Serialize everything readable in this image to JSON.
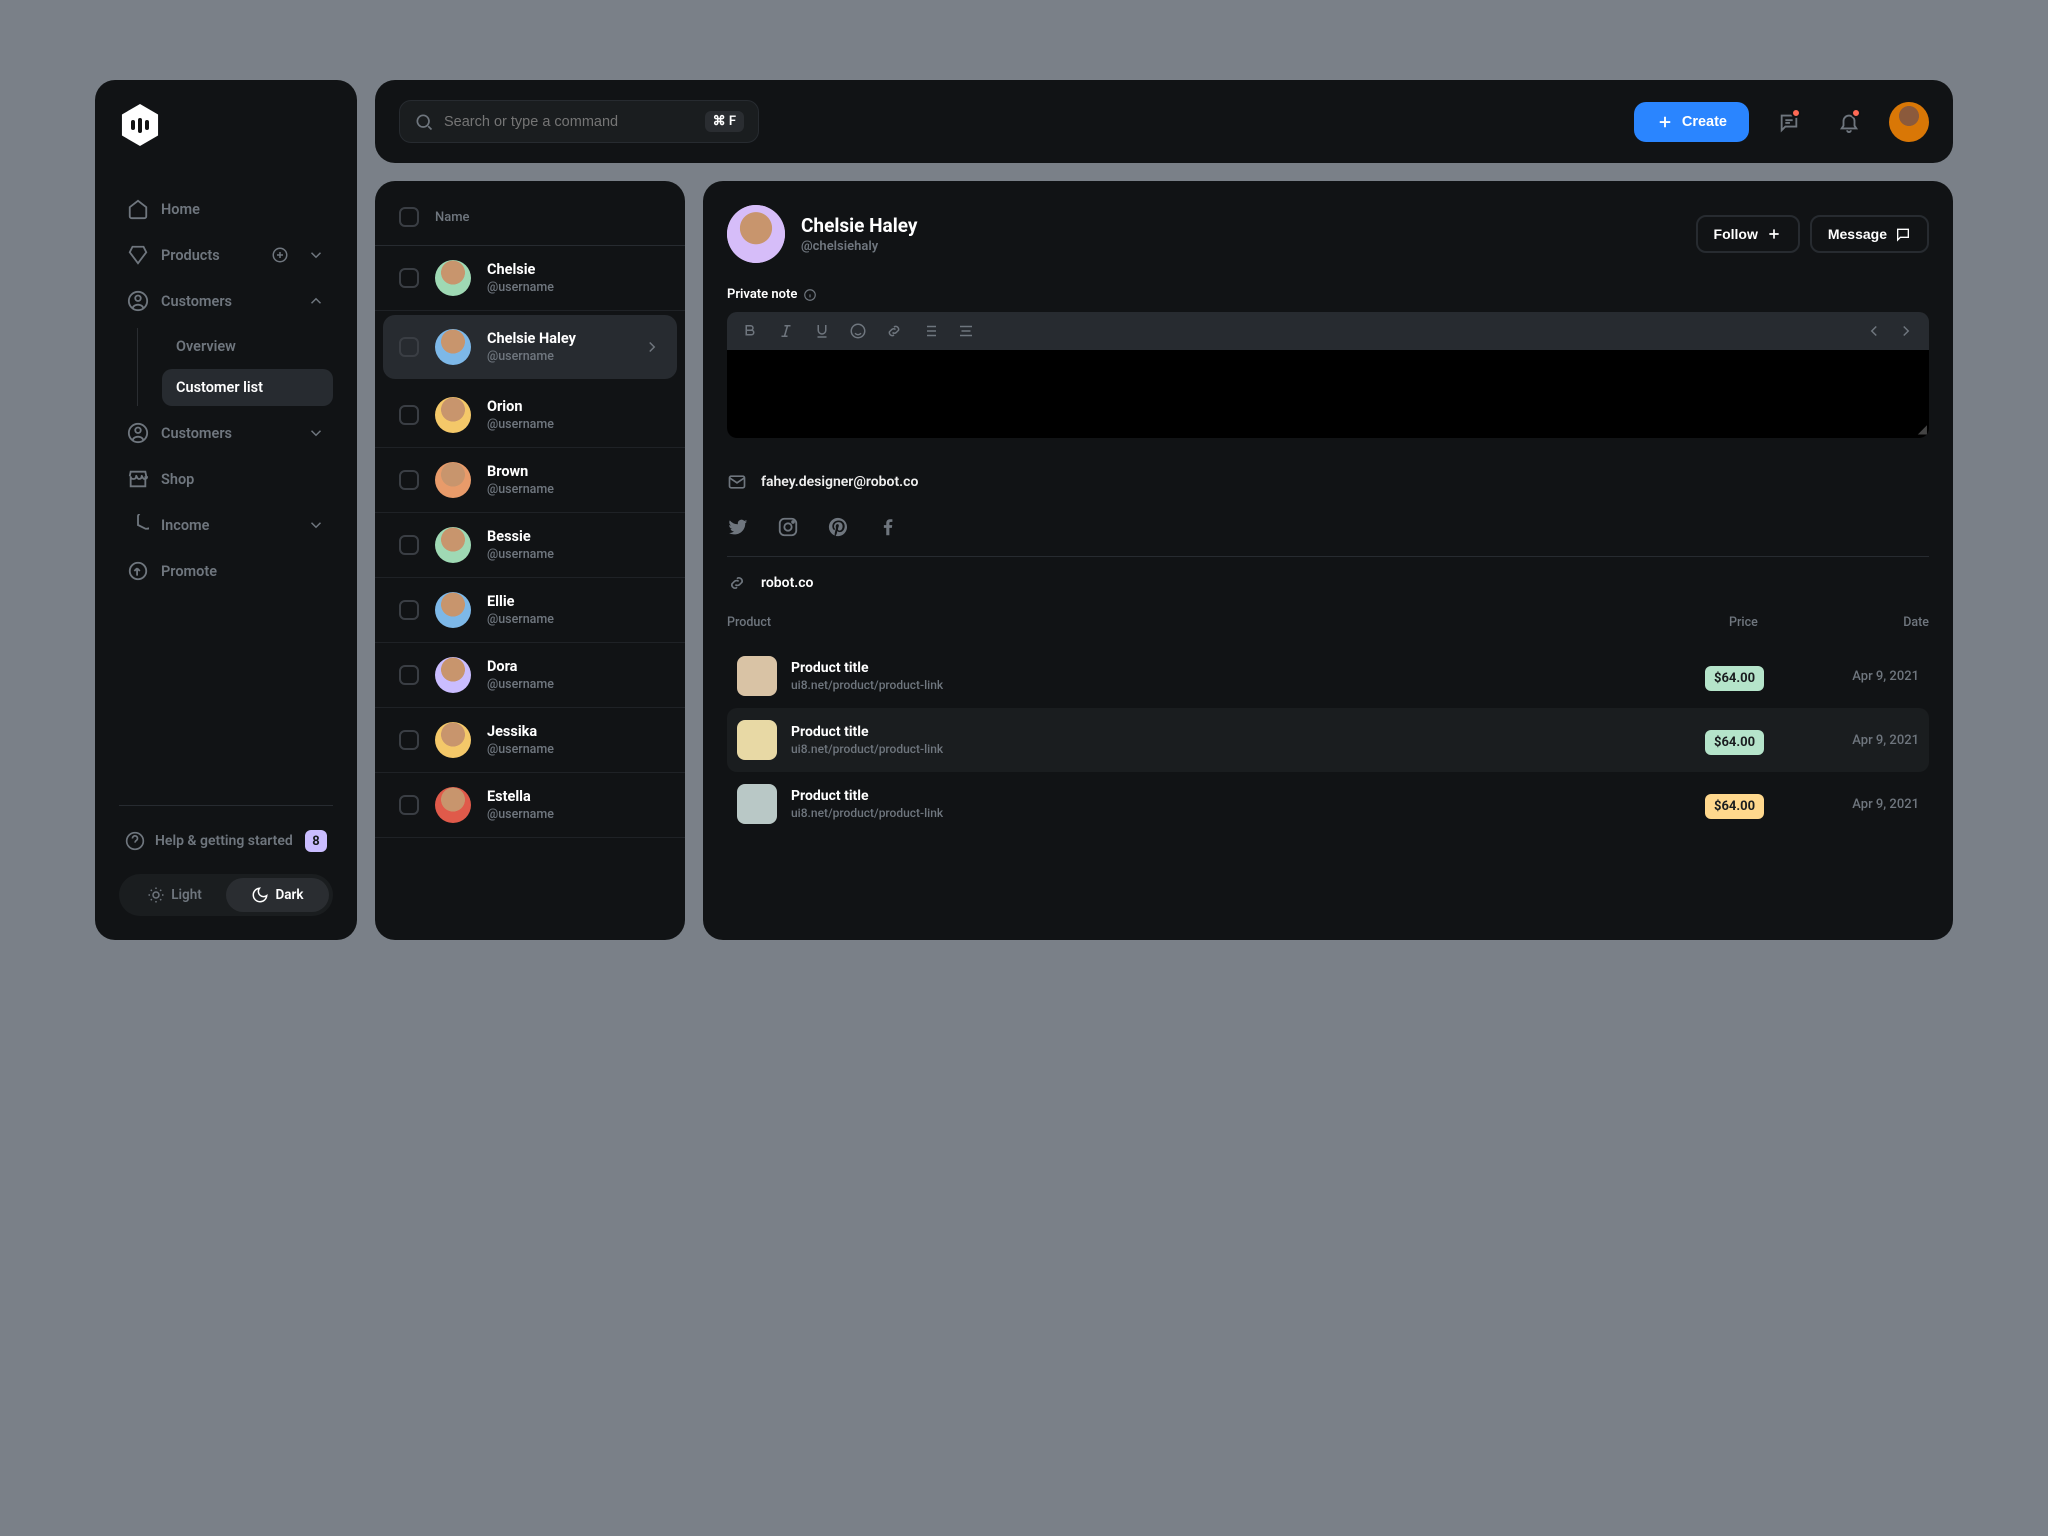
{
  "sidebar": {
    "items": [
      {
        "label": "Home"
      },
      {
        "label": "Products"
      },
      {
        "label": "Customers",
        "sub": [
          {
            "label": "Overview"
          },
          {
            "label": "Customer list"
          }
        ]
      },
      {
        "label": "Customers"
      },
      {
        "label": "Shop"
      },
      {
        "label": "Income"
      },
      {
        "label": "Promote"
      }
    ],
    "help": "Help & getting started",
    "help_count": "8",
    "light": "Light",
    "dark": "Dark"
  },
  "topbar": {
    "search_placeholder": "Search or type a command",
    "kbd": "⌘ F",
    "create": "Create"
  },
  "list": {
    "header": "Name",
    "customers": [
      {
        "name": "Chelsie",
        "handle": "@username",
        "color": "#9fd9b4"
      },
      {
        "name": "Chelsie Haley",
        "handle": "@username",
        "color": "#7db8e8",
        "selected": true
      },
      {
        "name": "Orion",
        "handle": "@username",
        "color": "#f4c869"
      },
      {
        "name": "Brown",
        "handle": "@username",
        "color": "#e89b6a"
      },
      {
        "name": "Bessie",
        "handle": "@username",
        "color": "#9fd9b4"
      },
      {
        "name": "Ellie",
        "handle": "@username",
        "color": "#7db8e8"
      },
      {
        "name": "Dora",
        "handle": "@username",
        "color": "#cabdff"
      },
      {
        "name": "Jessika",
        "handle": "@username",
        "color": "#f4c869"
      },
      {
        "name": "Estella",
        "handle": "@username",
        "color": "#e05a4a"
      }
    ]
  },
  "detail": {
    "name": "Chelsie Haley",
    "handle": "@chelsiehaly",
    "follow": "Follow",
    "message": "Message",
    "private_note": "Private note",
    "email": "fahey.designer@robot.co",
    "website": "robot.co",
    "cols": {
      "product": "Product",
      "price": "Price",
      "date": "Date"
    },
    "products": [
      {
        "title": "Product title",
        "link": "ui8.net/product/product-link",
        "price": "$64.00",
        "date": "Apr 9, 2021",
        "thumb": "#d9c3a5",
        "pill": "#b5e4ca"
      },
      {
        "title": "Product title",
        "link": "ui8.net/product/product-link",
        "price": "$64.00",
        "date": "Apr 9, 2021",
        "thumb": "#e8d9a5",
        "pill": "#b5e4ca",
        "hover": true
      },
      {
        "title": "Product title",
        "link": "ui8.net/product/product-link",
        "price": "$64.00",
        "date": "Apr 9, 2021",
        "thumb": "#b9c8c6",
        "pill": "#ffd88d"
      }
    ]
  }
}
